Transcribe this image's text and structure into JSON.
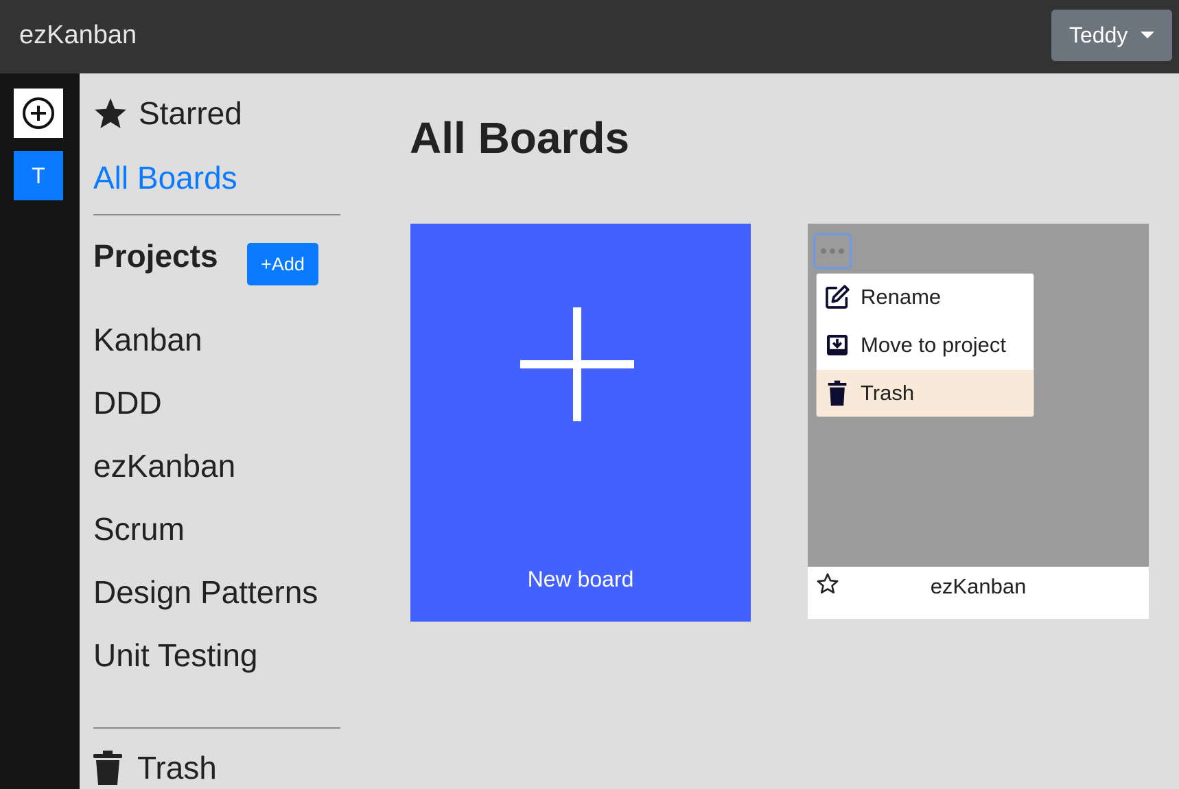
{
  "header": {
    "brand": "ezKanban",
    "user_name": "Teddy"
  },
  "rail": {
    "team_initial": "T"
  },
  "sidebar": {
    "starred_label": "Starred",
    "all_boards_label": "All Boards",
    "projects_heading": "Projects",
    "add_project_label": "+Add",
    "projects": [
      {
        "label": "Kanban"
      },
      {
        "label": "DDD"
      },
      {
        "label": "ezKanban"
      },
      {
        "label": "Scrum"
      },
      {
        "label": "Design Patterns"
      },
      {
        "label": "Unit Testing"
      }
    ],
    "trash_label": "Trash"
  },
  "main": {
    "title": "All Boards",
    "new_board_label": "New board",
    "boards": [
      {
        "name": "ezKanban",
        "menu": [
          {
            "label": "Rename",
            "icon": "edit-icon"
          },
          {
            "label": "Move to project",
            "icon": "move-to-project-icon"
          },
          {
            "label": "Trash",
            "icon": "trash-icon",
            "highlighted": true
          }
        ]
      }
    ]
  },
  "colors": {
    "primary": "#0a7bff",
    "new_board": "#4361ff",
    "topbar": "#333333",
    "rail": "#141414",
    "menu_highlight": "#f9e9d8"
  }
}
